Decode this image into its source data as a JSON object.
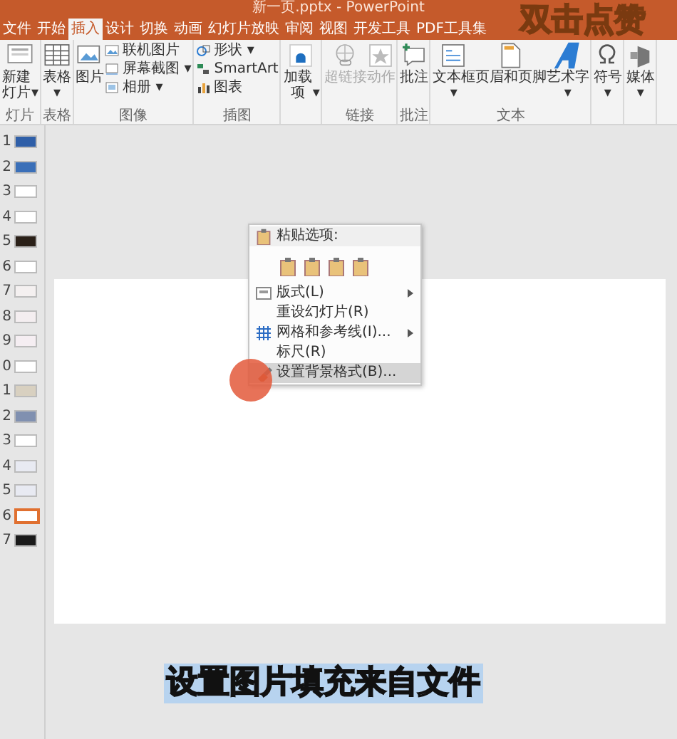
{
  "window": {
    "title": "新一页.pptx - PowerPoint"
  },
  "tabs": [
    {
      "label": "文件",
      "selected": false
    },
    {
      "label": "开始",
      "selected": false
    },
    {
      "label": "插入",
      "selected": true
    },
    {
      "label": "设计",
      "selected": false
    },
    {
      "label": "切换",
      "selected": false
    },
    {
      "label": "动画",
      "selected": false
    },
    {
      "label": "幻灯片放映",
      "selected": false
    },
    {
      "label": "审阅",
      "selected": false
    },
    {
      "label": "视图",
      "selected": false
    },
    {
      "label": "开发工具",
      "selected": false
    },
    {
      "label": "PDF工具集",
      "selected": false
    }
  ],
  "ribbon_groups": [
    {
      "label": "灯片",
      "items": [
        {
          "kind": "large",
          "label": "新建灯片",
          "caret": "▾"
        }
      ]
    },
    {
      "label": "表格",
      "items": [
        {
          "kind": "large",
          "label": "表格",
          "caret": "▾"
        }
      ]
    },
    {
      "label": "图像",
      "items": [
        {
          "kind": "large",
          "label": "图片"
        },
        {
          "kind": "small",
          "label": "联机图片"
        },
        {
          "kind": "small",
          "label": "屏幕截图",
          "caret": "▾"
        },
        {
          "kind": "small",
          "label": "相册",
          "caret": "▾"
        }
      ]
    },
    {
      "label": "插图",
      "items": [
        {
          "kind": "small",
          "label": "形状",
          "caret": "▾"
        },
        {
          "kind": "small",
          "label": "SmartArt"
        },
        {
          "kind": "small",
          "label": "图表"
        }
      ]
    },
    {
      "items": [
        {
          "kind": "large",
          "label": "加载项",
          "caret": "▾"
        }
      ]
    },
    {
      "label": "链接",
      "items": [
        {
          "kind": "large",
          "label": "超链接",
          "disabled": true
        },
        {
          "kind": "large",
          "label": "动作",
          "disabled": true
        }
      ]
    },
    {
      "label": "批注",
      "items": [
        {
          "kind": "large",
          "label": "批注"
        }
      ]
    },
    {
      "label": "文本",
      "items": [
        {
          "kind": "large",
          "label": "文本框",
          "caret": "▾"
        },
        {
          "kind": "large",
          "label": "页眉和页脚"
        },
        {
          "kind": "large",
          "label": "艺术字",
          "caret": "▾"
        }
      ]
    },
    {
      "items": [
        {
          "kind": "large",
          "label": "符号",
          "caret": "▾"
        }
      ]
    },
    {
      "items": [
        {
          "kind": "large",
          "label": "媒体",
          "caret": "▾"
        }
      ]
    }
  ],
  "sticker": "双击点赞",
  "slides": [
    {
      "number": "1",
      "selected": false,
      "color": "#2f5fa8"
    },
    {
      "number": "2",
      "selected": false,
      "color": "#3a6fb8"
    },
    {
      "number": "3",
      "selected": false,
      "color": "#ffffff"
    },
    {
      "number": "4",
      "selected": false,
      "color": "#ffffff"
    },
    {
      "number": "5",
      "selected": false,
      "color": "#2a2018"
    },
    {
      "number": "6",
      "selected": false,
      "color": "#ffffff"
    },
    {
      "number": "7",
      "selected": false,
      "color": "#f4f0f0"
    },
    {
      "number": "8",
      "selected": false,
      "color": "#f4eef0"
    },
    {
      "number": "9",
      "selected": false,
      "color": "#f5eef2"
    },
    {
      "number": "0",
      "selected": false,
      "color": "#ffffff"
    },
    {
      "number": "1",
      "selected": false,
      "color": "#d8d0c0"
    },
    {
      "number": "2",
      "selected": false,
      "color": "#8090b0"
    },
    {
      "number": "3",
      "selected": false,
      "color": "#ffffff"
    },
    {
      "number": "4",
      "selected": false,
      "color": "#e8eaf2"
    },
    {
      "number": "5",
      "selected": false,
      "color": "#e8eaf2"
    },
    {
      "number": "6",
      "selected": true,
      "color": "#ffffff"
    },
    {
      "number": "7",
      "selected": false,
      "color": "#1a1a1a"
    }
  ],
  "context_menu": {
    "items": [
      {
        "kind": "header",
        "label": "粘贴选项:"
      },
      {
        "kind": "paste"
      },
      {
        "kind": "item",
        "label": "版式(L)",
        "submenu": true,
        "highlighted": false
      },
      {
        "kind": "item",
        "label": "重设幻灯片(R)",
        "submenu": false,
        "highlighted": false
      },
      {
        "kind": "item",
        "label": "网格和参考线(I)...",
        "submenu": true,
        "highlighted": false
      },
      {
        "kind": "item",
        "label": "标尺(R)",
        "submenu": false,
        "highlighted": false
      },
      {
        "kind": "item",
        "label": "设置背景格式(B)...",
        "submenu": false,
        "highlighted": true
      }
    ]
  },
  "subtitle": "设置图片填充来自文件"
}
